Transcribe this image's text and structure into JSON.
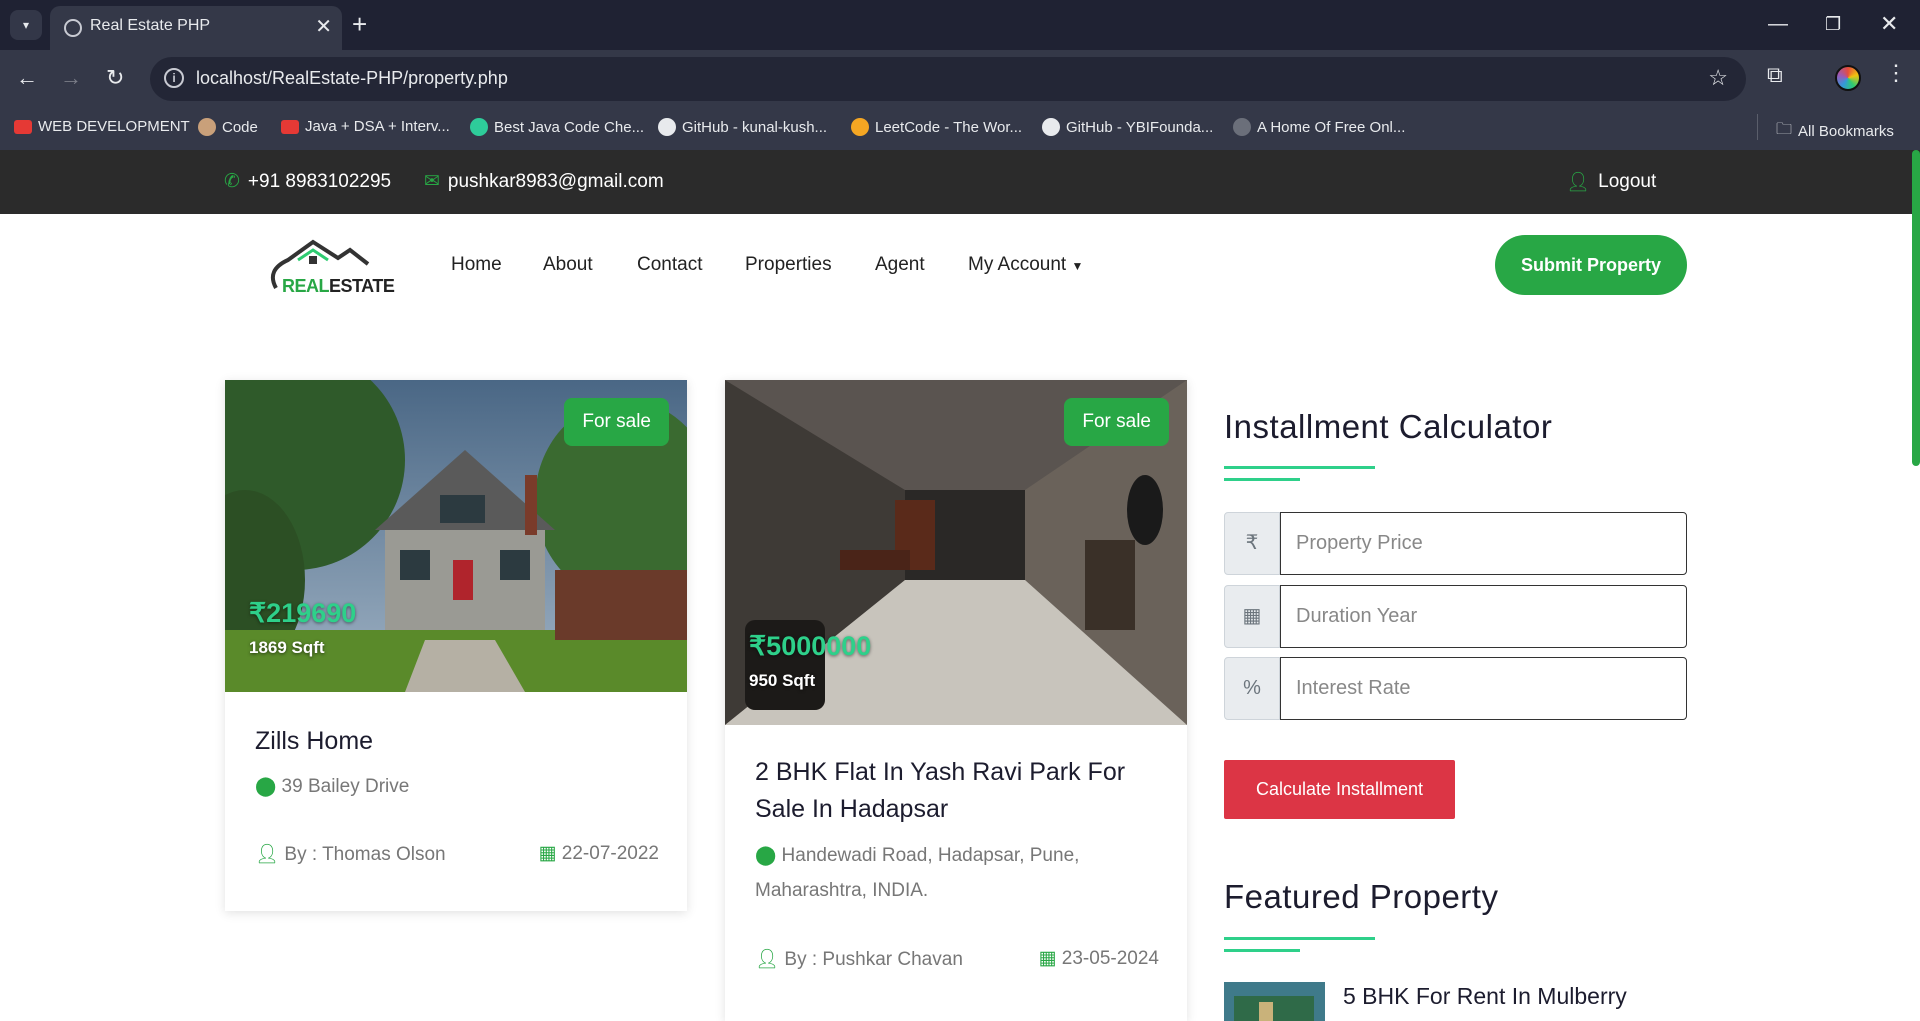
{
  "browser": {
    "tab_title": "Real Estate PHP",
    "url": "localhost/RealEstate-PHP/property.php",
    "bookmarks": [
      {
        "label": "WEB DEVELOPMENT",
        "icon": "youtube-icon"
      },
      {
        "label": "Code",
        "icon": "avatar-icon"
      },
      {
        "label": "Java + DSA + Interv...",
        "icon": "youtube-icon"
      },
      {
        "label": "Best Java Code Che...",
        "icon": "cloud-icon"
      },
      {
        "label": "GitHub - kunal-kush...",
        "icon": "github-icon"
      },
      {
        "label": "LeetCode - The Wor...",
        "icon": "leetcode-icon"
      },
      {
        "label": "GitHub - YBIFounda...",
        "icon": "github-icon"
      },
      {
        "label": "A Home Of Free Onl...",
        "icon": "bug-icon"
      }
    ],
    "all_bookmarks": "All Bookmarks"
  },
  "topbar": {
    "phone": "+91 8983102295",
    "email": "pushkar8983@gmail.com",
    "logout": "Logout"
  },
  "header": {
    "logo_text_a": "REAL",
    "logo_text_b": "ESTATE",
    "nav": [
      "Home",
      "About",
      "Contact",
      "Properties",
      "Agent",
      "My Account"
    ],
    "submit": "Submit Property"
  },
  "cards": [
    {
      "badge": "For sale",
      "price": "₹219690",
      "sqft": "1869 Sqft",
      "title": "Zills Home",
      "address": "39 Bailey Drive",
      "by": "By : Thomas Olson",
      "date": "22-07-2022"
    },
    {
      "badge": "For sale",
      "price": "₹5000000",
      "sqft": "950 Sqft",
      "title": "2 BHK Flat In Yash Ravi Park For Sale In Hadapsar",
      "address": "Handewadi Road, Hadapsar, Pune, Maharashtra, INDIA.",
      "by": "By : Pushkar Chavan",
      "date": "23-05-2024"
    }
  ],
  "calculator": {
    "heading": "Installment Calculator",
    "price_addon": "₹",
    "price_placeholder": "Property Price",
    "duration_placeholder": "Duration Year",
    "rate_addon": "%",
    "rate_placeholder": "Interest Rate",
    "button": "Calculate Installment"
  },
  "featured": {
    "heading": "Featured Property",
    "first_title": "5 BHK For Rent In Mulberry"
  },
  "colors": {
    "accent_green": "#28a745",
    "price_green": "#2ed08a",
    "calc_red": "#dc3545",
    "topbar_bg": "#2b2b2b"
  }
}
